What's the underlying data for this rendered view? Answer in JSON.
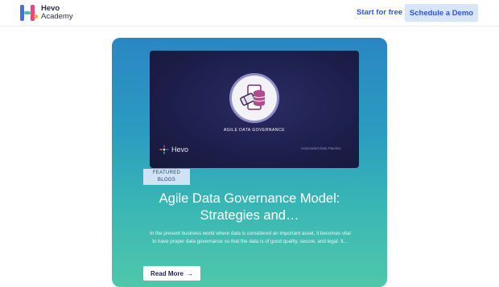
{
  "header": {
    "logo_line1": "Hevo",
    "logo_line2": "Academy",
    "start_label": "Start for free",
    "demo_label": "Schedule a Demo"
  },
  "featured": {
    "thumbnail": {
      "title": "AGILE DATA GOVERNANCE",
      "logo_text": "Hevo",
      "footer_text": "Automated Data Pipeline"
    },
    "badge_line1": "FEATURED",
    "badge_line2": "BLOGS",
    "title_line1": "Agile Data Governance Model:",
    "title_line2": "Strategies and…",
    "excerpt": "In the present business world where data is considered an important asset, it becomes vital to have proper data governance so that the data is of good quality, secure, and legal. It…",
    "read_more_label": "Read More",
    "read_more_icon": "arrow-right-icon"
  },
  "colors": {
    "accent": "#2f54eb",
    "demo_bg": "#d7e6fb",
    "card_top": "#2a86c2",
    "card_bottom": "#4fc7ab",
    "thumb_bg": "#1d1f4c"
  }
}
